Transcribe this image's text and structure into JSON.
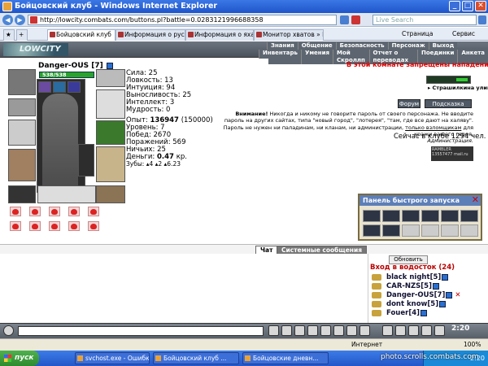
{
  "window": {
    "title": "Бойцовский клуб - Windows Internet Explorer",
    "min": "_",
    "max": "□",
    "close": "✕"
  },
  "browser": {
    "url": "http://lowcity.combats.com/buttons.pl?battle=0.0283121996688358",
    "search_placeholder": "Live Search",
    "tabs": [
      "Бойцовский клуб",
      "Информация о русал...",
      "Информация о яхан...",
      "Монитор хватов » К..."
    ],
    "tools": [
      "Страница",
      "Сервис"
    ]
  },
  "game": {
    "logo": "LOWCITY",
    "nav_top": [
      "Знания",
      "Общение",
      "Безопасность",
      "Персонаж",
      "Выход"
    ],
    "nav_bottom": [
      "Инвентарь",
      "Умения",
      "Мой Скроллп",
      "Отчет о переводах",
      "Поединки",
      "Анкета"
    ],
    "warning": "В этой комнате запрещены нападения",
    "location": "Страшилкина улица",
    "buttons": {
      "forum": "Форум",
      "hints": "Подсказка"
    },
    "notice": {
      "bold": "Внимание!",
      "text1": "Никогда и никому не говорите пароль от своего персонажа. Не вводите пароль на",
      "text2": "других сайтах, типа \"новый город\", \"лотерея\", \"там, где все дают на халяву\". Пароль не нужен ни",
      "text3": "паладинам, ни кланам, ни администрации,",
      "link": "только взломщикам",
      "text4": "для кражи вашего героя.",
      "sign": "Администрация."
    },
    "online": "Сейчас в клубе 1294 чел.",
    "counter": "RAMBLER 13557477 mail.ru"
  },
  "character": {
    "name": "Danger-OUS",
    "level": "[7]",
    "hp": "538/538",
    "stats": [
      "Сила: 25",
      "Ловкость: 13",
      "Интуиция: 94",
      "Выносливость: 25",
      "Интеллект: 3",
      "Мудрость: 0"
    ],
    "exp_label": "Опыт:",
    "exp_value": "136947",
    "exp_next": "(150000)",
    "info": [
      "Уровень: 7",
      "Побед: 2670",
      "Поражений: 569",
      "Ничьих: 25"
    ],
    "money_label": "Деньги:",
    "money_value": "0.47",
    "money_unit": "кр.",
    "teeth": "Зубы: ▴4 ▴2 ▴6.23"
  },
  "quickpanel": {
    "title": "Панель быстрого запуска",
    "close": "✕"
  },
  "chat": {
    "tab_chat": "Чат",
    "tab_system": "Системные сообщения",
    "refresh": "Обновить",
    "room": "Вход в водосток (24)",
    "players": [
      {
        "name": "black night",
        "level": "[5]"
      },
      {
        "name": "CAR-NZS",
        "level": "[5]"
      },
      {
        "name": "Danger-OUS",
        "level": "[7]"
      },
      {
        "name": "dont know",
        "level": "[5]"
      },
      {
        "name": "Fouer",
        "level": "[4]"
      }
    ]
  },
  "clock": "2:20",
  "statusbar": {
    "zone": "Интернет",
    "zoom": "100%"
  },
  "taskbar": {
    "start": "пуск",
    "tasks": [
      "svchost.exe - Ошибк...",
      "Бойцовский клуб ...",
      "Бойцовские дневн..."
    ],
    "time": "2:20"
  },
  "watermark": "photo.scrolls.combats.com"
}
